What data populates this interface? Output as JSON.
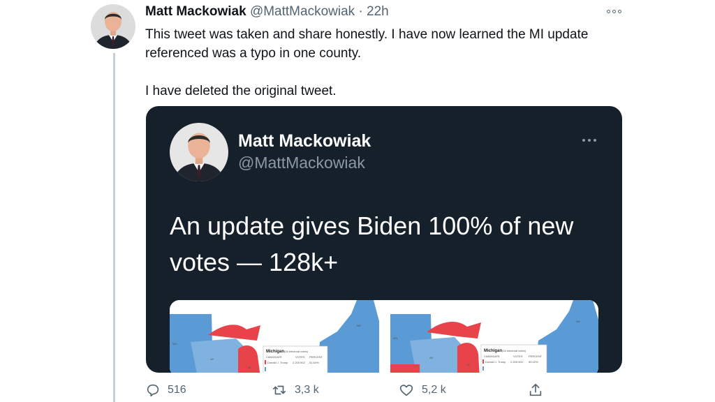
{
  "tweet": {
    "author_name": "Matt Mackowiak",
    "author_handle": "@MattMackowiak",
    "separator": "·",
    "timestamp": "22h",
    "text_p1": "This tweet was taken and share honestly. I have now learned the MI update referenced was a typo in one county.",
    "text_p2": "I have deleted the original tweet."
  },
  "embedded": {
    "author_name": "Matt Mackowiak",
    "author_handle": "@MattMackowiak",
    "text": "An update gives Biden 100% of new votes — 128k+",
    "maps": [
      {
        "states": [
          "MN",
          "WI",
          "MI",
          "ME"
        ],
        "inset_title": "Michigan",
        "inset_subtitle": "(16 electoral votes)",
        "col_candidate": "CANDIDATE",
        "col_votes": "VOTES",
        "col_percent": "PERCENT",
        "row_name": "Donald J. Trump",
        "row_votes": "2,200,902",
        "row_percent": "51.64%"
      },
      {
        "states": [
          "MN",
          "WI",
          "MI",
          "ME"
        ],
        "inset_title": "Michigan",
        "inset_subtitle": "(16 electoral votes)",
        "col_candidate": "CANDIDATE",
        "col_votes": "VOTES",
        "col_percent": "PERCENT",
        "row_name": "Donald J. Trump",
        "row_votes": "2,200,902",
        "row_percent": "50.02%"
      }
    ],
    "colors": {
      "dem": "#5b9bd5",
      "rep": "#e8434b",
      "card_bg": "#15202b"
    }
  },
  "actions": {
    "reply_count": "516",
    "retweet_count": "3,3 k",
    "like_count": "5,2 k"
  },
  "icons": [
    "more-icon",
    "reply-icon",
    "retweet-icon",
    "like-icon",
    "share-icon"
  ]
}
